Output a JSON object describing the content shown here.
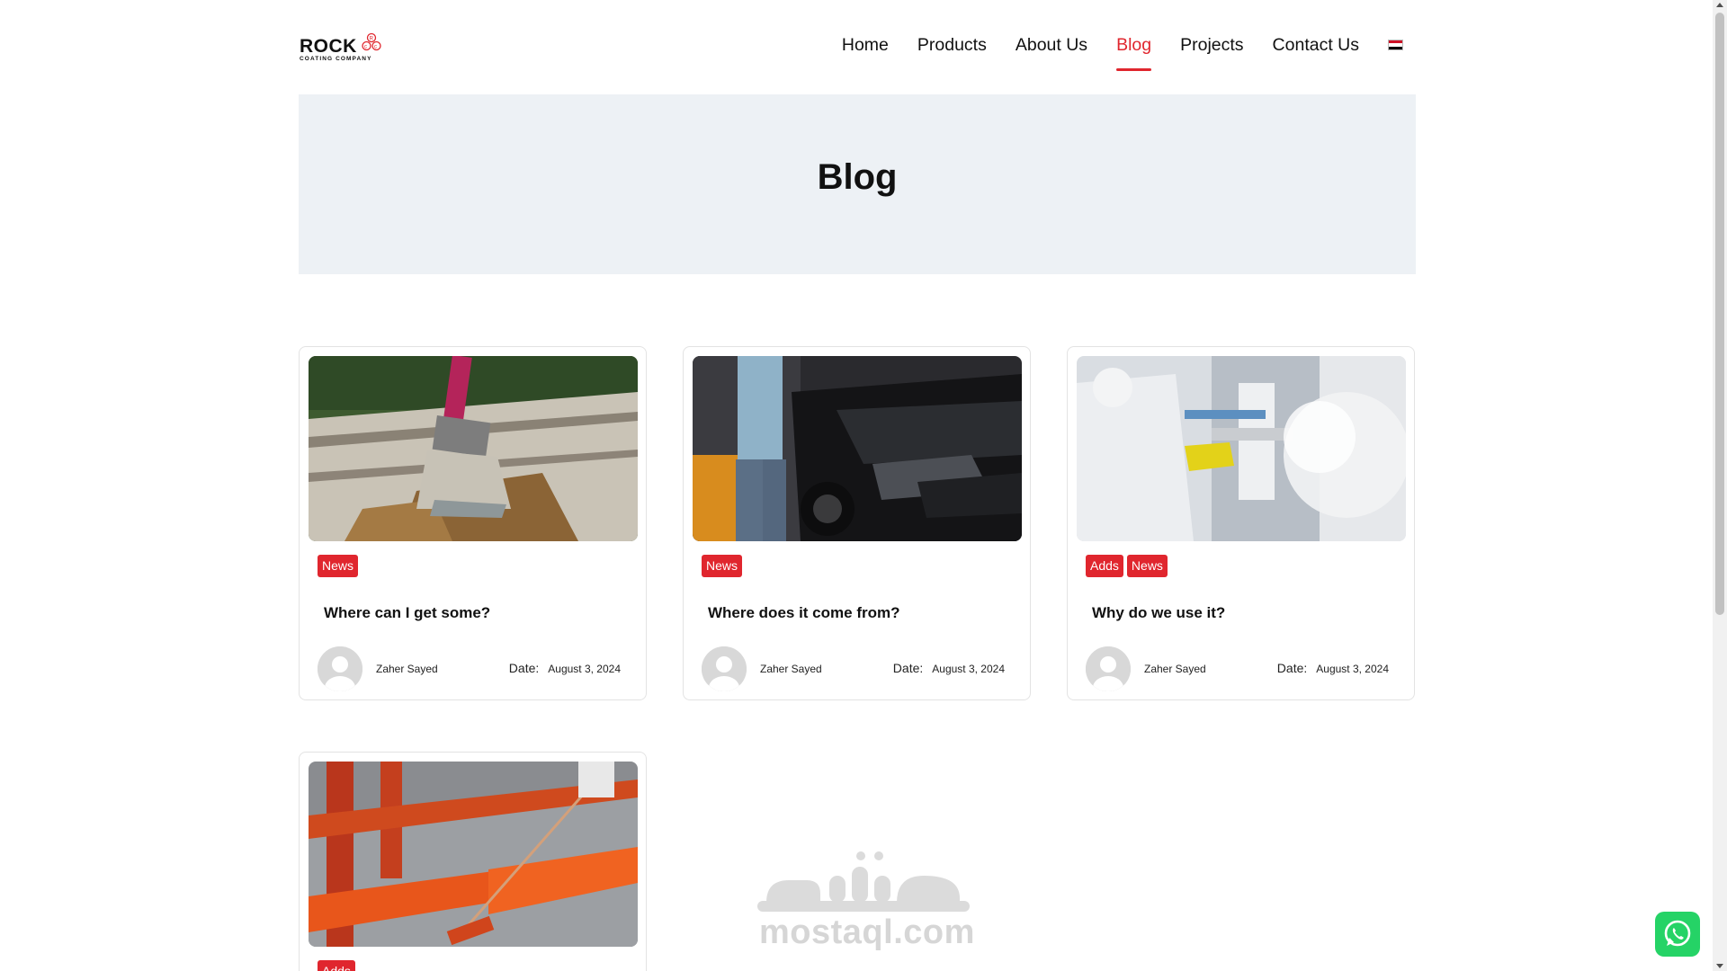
{
  "header": {
    "logo_word": "ROCK",
    "logo_sub": "COATING COMPANY",
    "logo_mark_text": "cc",
    "nav": [
      {
        "label": "Home",
        "active": false
      },
      {
        "label": "Products",
        "active": false
      },
      {
        "label": "About Us",
        "active": false
      },
      {
        "label": "Blog",
        "active": true
      },
      {
        "label": "Projects",
        "active": false
      },
      {
        "label": "Contact Us",
        "active": false
      }
    ],
    "language_flag": "egypt-flag-icon"
  },
  "hero": {
    "title": "Blog"
  },
  "posts": [
    {
      "image": "paint-brush-on-wood",
      "tags": [
        "News"
      ],
      "title": "Where can I get some?",
      "author": "Zaher Sayed",
      "date_label": "Date:",
      "date": "August 3, 2024"
    },
    {
      "image": "car-detailing",
      "tags": [
        "News"
      ],
      "title": "Where does it come from?",
      "author": "Zaher Sayed",
      "date_label": "Date:",
      "date": "August 3, 2024"
    },
    {
      "image": "powder-coating-spray",
      "tags": [
        "Adds",
        "News"
      ],
      "title": "Why do we use it?",
      "author": "Zaher Sayed",
      "date_label": "Date:",
      "date": "August 3, 2024"
    },
    {
      "image": "roller-painting-metal",
      "tags": [
        "Adds"
      ],
      "title": "",
      "author": "",
      "date_label": "",
      "date": ""
    }
  ],
  "watermark": {
    "text": "mostaql.com"
  },
  "colors": {
    "accent": "#e0262e",
    "hero_bg": "#edf1f5",
    "whatsapp": "#25d366"
  }
}
